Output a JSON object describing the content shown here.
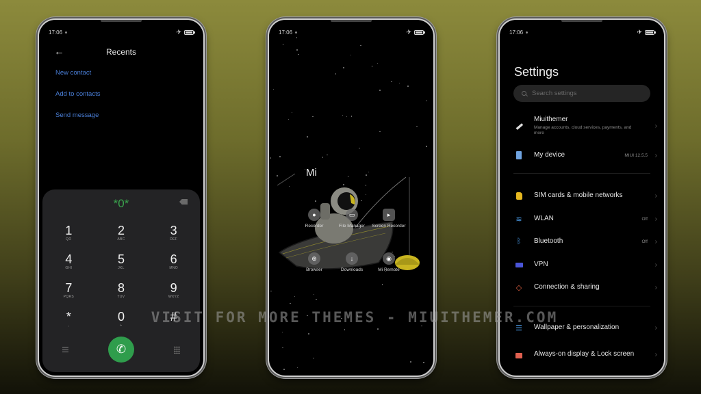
{
  "status_bar": {
    "time": "17:06"
  },
  "dialer": {
    "title": "Recents",
    "links": [
      "New contact",
      "Add to contacts",
      "Send message"
    ],
    "dialed_number": "*0*",
    "keys": [
      {
        "num": "1",
        "letters": "QO"
      },
      {
        "num": "2",
        "letters": "ABC"
      },
      {
        "num": "3",
        "letters": "DEF"
      },
      {
        "num": "4",
        "letters": "GHI"
      },
      {
        "num": "5",
        "letters": "JKL"
      },
      {
        "num": "6",
        "letters": "MNO"
      },
      {
        "num": "7",
        "letters": "PQRS"
      },
      {
        "num": "8",
        "letters": "TUV"
      },
      {
        "num": "9",
        "letters": "WXYZ"
      },
      {
        "num": "*",
        "letters": ","
      },
      {
        "num": "0",
        "letters": "+"
      },
      {
        "num": "#",
        "letters": ""
      }
    ],
    "call_color": "#2f9d4c",
    "accent": "#4a7fd8"
  },
  "home": {
    "folder_title": "Mi",
    "apps": [
      {
        "label": "Recorder",
        "icon": "record-icon"
      },
      {
        "label": "File Manager",
        "icon": "folder-icon"
      },
      {
        "label": "Screen Recorder",
        "icon": "video-icon"
      },
      {
        "label": "Browser",
        "icon": "globe-icon"
      },
      {
        "label": "Downloads",
        "icon": "download-icon"
      },
      {
        "label": "Mi Remote",
        "icon": "remote-icon"
      }
    ]
  },
  "settings": {
    "title": "Settings",
    "search_placeholder": "Search settings",
    "items": [
      {
        "label": "Miuithemer",
        "sub": "Manage accounts, cloud services, payments, and more",
        "value": "",
        "icon": "account-icon"
      },
      {
        "label": "My device",
        "sub": "",
        "value": "MIUI 12.5.5",
        "icon": "device-icon"
      },
      {
        "label": "SIM cards & mobile networks",
        "sub": "",
        "value": "",
        "icon": "sim-icon"
      },
      {
        "label": "WLAN",
        "sub": "",
        "value": "Off",
        "icon": "wifi-icon"
      },
      {
        "label": "Bluetooth",
        "sub": "",
        "value": "Off",
        "icon": "bluetooth-icon"
      },
      {
        "label": "VPN",
        "sub": "",
        "value": "",
        "icon": "vpn-icon"
      },
      {
        "label": "Connection & sharing",
        "sub": "",
        "value": "",
        "icon": "share-icon"
      },
      {
        "label": "Wallpaper & personalization",
        "sub": "",
        "value": "",
        "icon": "wallpaper-icon"
      },
      {
        "label": "Always-on display & Lock screen",
        "sub": "",
        "value": "",
        "icon": "lock-icon"
      }
    ]
  },
  "watermark": "VISIT FOR MORE THEMES - MIUITHEMER.COM"
}
